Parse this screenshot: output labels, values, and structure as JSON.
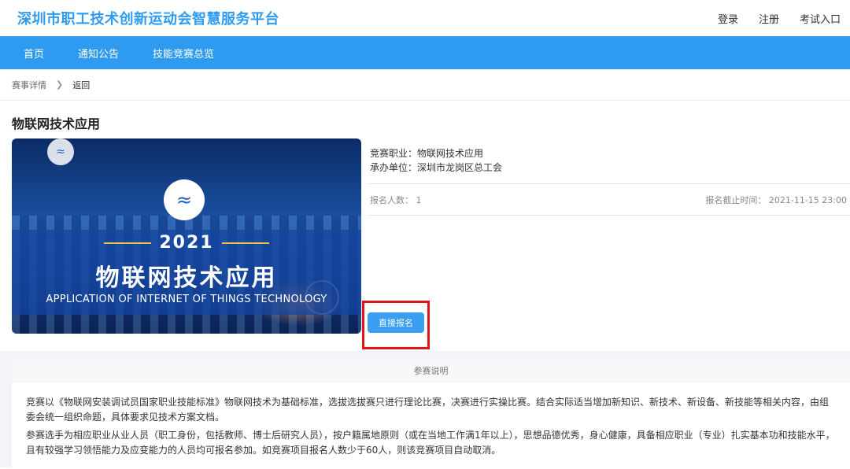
{
  "header": {
    "site_title": "深圳市职工技术创新运动会智慧服务平台",
    "links": [
      "登录",
      "注册",
      "考试入口"
    ]
  },
  "nav": {
    "items": [
      "首页",
      "通知公告",
      "技能竞赛总览"
    ]
  },
  "breadcrumb": {
    "current": "赛事详情",
    "back": "返回"
  },
  "event": {
    "title": "物联网技术应用",
    "banner": {
      "year": "2021",
      "title_cn": "物联网技术应用",
      "title_en": "APPLICATION OF INTERNET OF THINGS TECHNOLOGY"
    },
    "occupation": "竞赛职业：物联网技术应用",
    "organizer": "承办单位：深圳市龙岗区总工会",
    "signup_count": "报名人数： 1",
    "deadline": "报名截止时间： 2021-11-15 23:00",
    "apply_label": "直接报名"
  },
  "description": {
    "heading": "参赛说明",
    "paragraphs": [
      "竞赛以《物联网安装调试员国家职业技能标准》物联网技术为基础标准，选拔选拔赛只进行理论比赛，决赛进行实操比赛。结合实际适当增加新知识、新技术、新设备、新技能等相关内容，由组委会统一组织命题，具体要求见技术方案文档。",
      "参赛选手为相应职业从业人员（职工身份，包括教师、博士后研究人员），按户籍属地原则（或在当地工作满1年以上），思想品德优秀，身心健康，具备相应职业（专业）扎实基本功和技能水平，且有较强学习领悟能力及应变能力的人员均可报名参加。如竞赛项目报名人数少于60人，则该竞赛项目自动取消。"
    ]
  },
  "icons": {
    "banner_wifi": "wifi-icon",
    "breadcrumb_sep": "chevron-right-icon"
  },
  "colors": {
    "brand": "#2f9bf0",
    "highlight": "#e0151a"
  }
}
